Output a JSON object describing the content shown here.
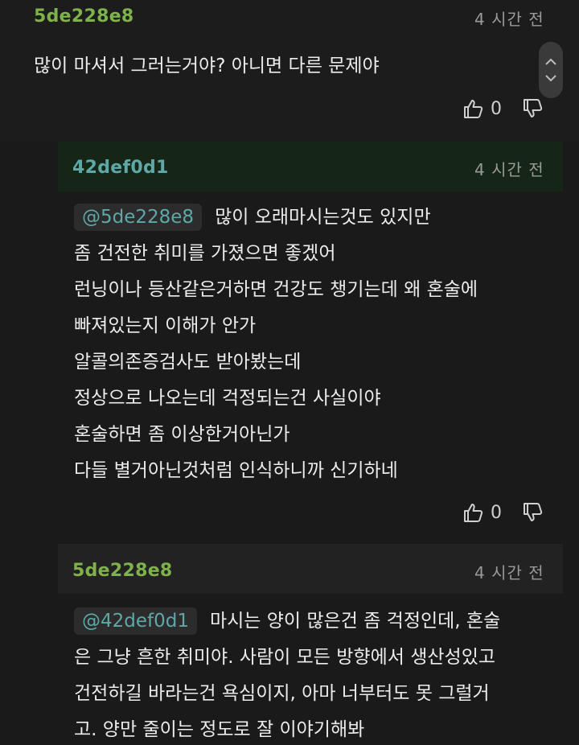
{
  "colors": {
    "user_green": "#7fb24a",
    "user_teal": "#5fa8a8",
    "mention": "#5fa8a8",
    "timestamp": "#9a9a9a"
  },
  "top_comment": {
    "username": "5de228e8",
    "timestamp": "4 시간 전",
    "text": "많이 마셔서 그러는거야? 아니면 다른 문제야",
    "likes": "0"
  },
  "reply_1": {
    "username": "42def0d1",
    "timestamp": "4 시간 전",
    "mention": "@5de228e8",
    "lines": [
      "많이 오래마시는것도 있지만",
      "좀 건전한 취미를 가졌으면 좋겠어",
      "런닝이나 등산같은거하면 건강도 챙기는데 왜 혼술에",
      "빠져있는지 이해가 안가",
      "알콜의존증검사도 받아봤는데",
      "정상으로 나오는데 걱정되는건 사실이야",
      "혼술하면 좀 이상한거아닌가",
      "다들 별거아닌것처럼 인식하니까 신기하네"
    ],
    "likes": "0"
  },
  "reply_2": {
    "username": "5de228e8",
    "timestamp": "4 시간 전",
    "mention": "@42def0d1",
    "lines": [
      "마시는 양이 많은건 좀 걱정인데, 혼술",
      "은 그냥 흔한 취미야. 사람이 모든 방향에서 생산성있고",
      "건전하길 바라는건 욕심이지, 아마 너부터도 못 그럴거",
      "고. 양만 줄이는 정도로 잘 이야기해봐"
    ]
  },
  "icons": {
    "like": "thumbs-up-icon",
    "dislike": "thumbs-down-icon",
    "scroll_up": "chevron-up-icon",
    "scroll_down": "chevron-down-icon"
  }
}
